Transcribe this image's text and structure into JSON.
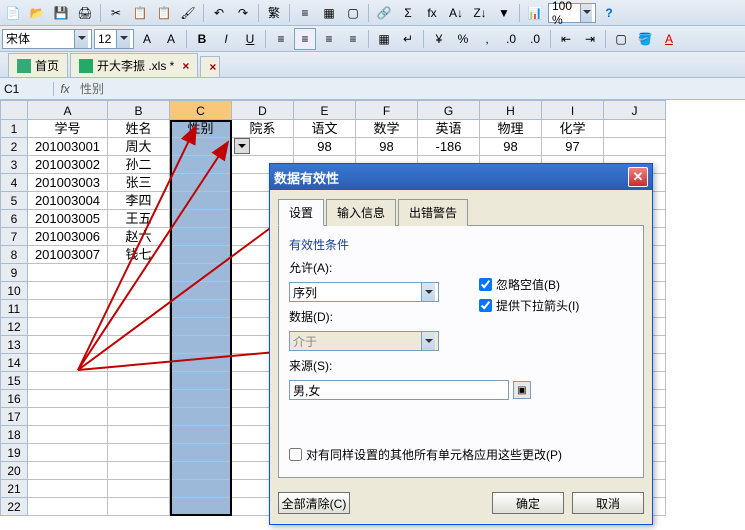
{
  "font": {
    "name": "宋体",
    "size": "12"
  },
  "zoom": "100 %",
  "tabs": {
    "home": "首页",
    "file": "开大李振 .xls *"
  },
  "formula": {
    "cellref": "C1",
    "fx": "fx",
    "value": "性别"
  },
  "cols": [
    "A",
    "B",
    "C",
    "D",
    "E",
    "F",
    "G",
    "H",
    "I",
    "J"
  ],
  "headers": {
    "A": "学号",
    "B": "姓名",
    "C": "性别",
    "D": "院系",
    "E": "语文",
    "F": "数学",
    "G": "英语",
    "H": "物理",
    "I": "化学"
  },
  "rows": [
    {
      "A": "201003001",
      "B": "周大",
      "E": "98",
      "F": "98",
      "G": "-186",
      "H": "98",
      "I": "97"
    },
    {
      "A": "201003002",
      "B": "孙二"
    },
    {
      "A": "201003003",
      "B": "张三"
    },
    {
      "A": "201003004",
      "B": "李四"
    },
    {
      "A": "201003005",
      "B": "王五"
    },
    {
      "A": "201003006",
      "B": "赵六"
    },
    {
      "A": "201003007",
      "B": "钱七"
    }
  ],
  "dialog": {
    "title": "数据有效性",
    "tabs": {
      "t1": "设置",
      "t2": "输入信息",
      "t3": "出错警告"
    },
    "group": "有效性条件",
    "allow_lbl": "允许(A):",
    "allow_val": "序列",
    "data_lbl": "数据(D):",
    "data_val": "介于",
    "source_lbl": "来源(S):",
    "source_val": "男,女",
    "cb1": "忽略空值(B)",
    "cb2": "提供下拉箭头(I)",
    "apply": "对有同样设置的其他所有单元格应用这些更改(P)",
    "clear": "全部清除(C)",
    "ok": "确定",
    "cancel": "取消"
  }
}
